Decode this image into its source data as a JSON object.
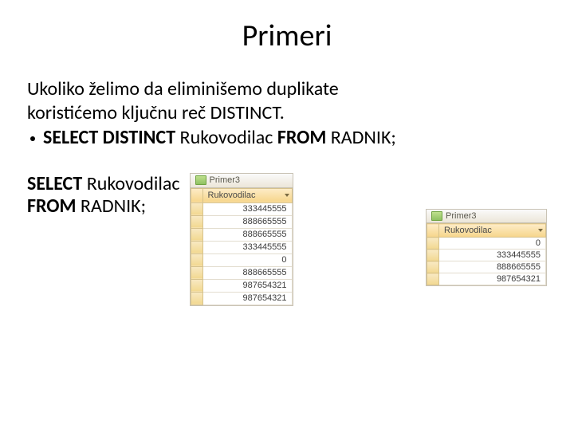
{
  "title": "Primeri",
  "intro_line1": "Ukoliko želimo da eliminišemo duplikate",
  "intro_line2": "koristićemo ključnu reč DISTINCT.",
  "bullet1": {
    "select": "SELECT DISTINCT",
    "col": " Rukovodilac ",
    "from": "FROM",
    "table": " RADNIK;"
  },
  "query2": {
    "select": "SELECT",
    "col": " Rukovodilac",
    "from": "FROM",
    "table": " RADNIK;"
  },
  "grid1": {
    "tab": "Primer3",
    "header": "Rukovodilac",
    "rows": [
      "333445555",
      "888665555",
      "888665555",
      "333445555",
      "0",
      "888665555",
      "987654321",
      "987654321"
    ]
  },
  "grid2": {
    "tab": "Primer3",
    "header": "Rukovodilac",
    "rows": [
      "0",
      "333445555",
      "888665555",
      "987654321"
    ]
  }
}
